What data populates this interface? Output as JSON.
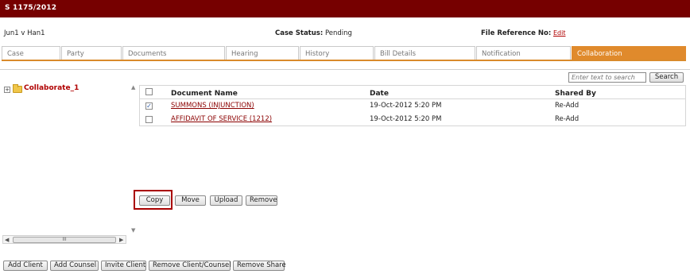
{
  "header": {
    "case_number": "S 1175/2012"
  },
  "info": {
    "party": "Jun1 v Han1",
    "status_label": "Case Status:",
    "status_value": "Pending",
    "file_label": "File Reference No:",
    "file_link": "Edit"
  },
  "tabs": [
    "Case",
    "Party",
    "Documents",
    "Hearing",
    "History",
    "Bill Details",
    "Notification",
    "Collaboration"
  ],
  "tree": {
    "root_label": "Collaborate_1",
    "expand_glyph": "+"
  },
  "search": {
    "placeholder": "Enter text to search",
    "button": "Search"
  },
  "grid": {
    "headers": {
      "name": "Document Name",
      "date": "Date",
      "shared_by": "Shared By"
    },
    "rows": [
      {
        "name": "SUMMONS (INJUNCTION)",
        "date": "19-Oct-2012 5:20 PM",
        "shared_by": "Re-Add",
        "checked": true
      },
      {
        "name": "AFFIDAVIT OF SERVICE (1212)",
        "date": "19-Oct-2012 5:20 PM",
        "shared_by": "Re-Add",
        "checked": false
      }
    ]
  },
  "doc_actions": {
    "copy": "Copy",
    "move": "Move",
    "upload": "Upload",
    "remove": "Remove"
  },
  "bottom_actions": {
    "add_client": "Add Client",
    "add_counsel": "Add Counsel",
    "invite_client": "Invite Client",
    "remove_client_counsel": "Remove Client/Counsel",
    "remove_share": "Remove Share"
  },
  "scroll": {
    "thumb_grip": "III"
  },
  "colors": {
    "title_bar": "#760000",
    "active_tab": "#e08a2c",
    "link": "#8b0000",
    "highlight": "#a90000"
  }
}
